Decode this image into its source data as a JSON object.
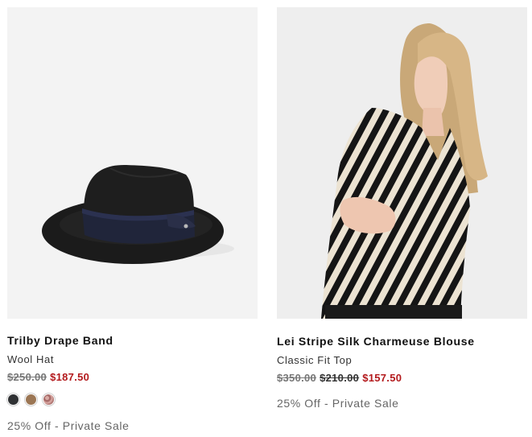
{
  "products": [
    {
      "name": "Trilby Drape Band",
      "subtitle": "Wool Hat",
      "original_price": "$250.00",
      "sale_price": "$187.50",
      "swatches": [
        {
          "name": "black",
          "color": "#2f3133"
        },
        {
          "name": "tan",
          "color": "#9b7654"
        },
        {
          "name": "pink-pattern",
          "color": "#c08a86"
        }
      ],
      "promo": "25% Off - Private Sale"
    },
    {
      "name": "Lei Stripe Silk Charmeuse Blouse",
      "subtitle": "Classic Fit Top",
      "original_price": "$350.00",
      "reduced_price": "$210.00",
      "sale_price": "$157.50",
      "promo": "25% Off - Private Sale"
    }
  ]
}
